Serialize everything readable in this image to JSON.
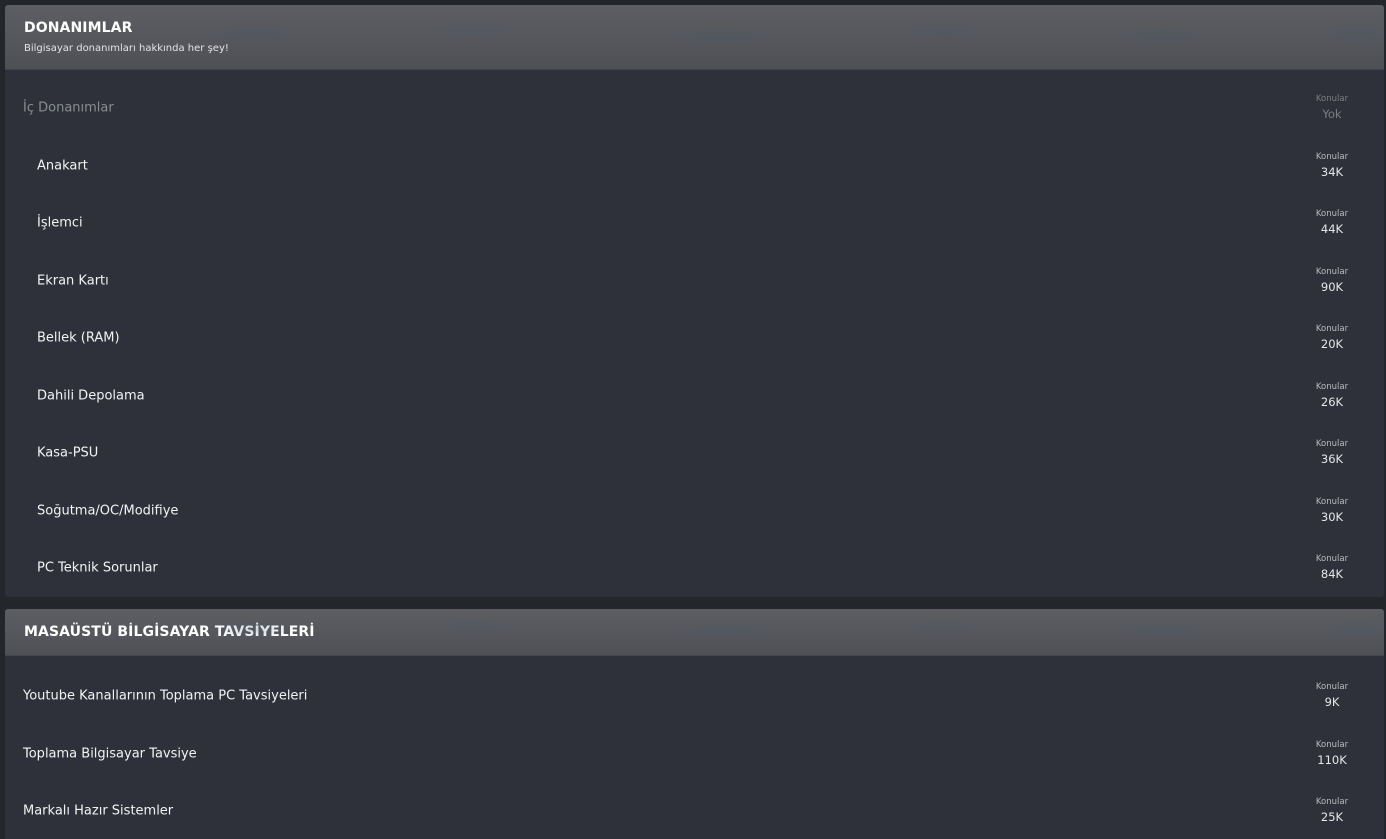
{
  "blocks": [
    {
      "title": "DONANIMLAR",
      "description": "Bilgisayar donanımları hakkında her şey!",
      "category": {
        "title": "İç Donanımlar",
        "stat_label": "Konular",
        "stat_value": "Yok"
      },
      "forums": [
        {
          "title": "Anakart",
          "stat_label": "Konular",
          "stat_value": "34K"
        },
        {
          "title": "İşlemci",
          "stat_label": "Konular",
          "stat_value": "44K"
        },
        {
          "title": "Ekran Kartı",
          "stat_label": "Konular",
          "stat_value": "90K"
        },
        {
          "title": "Bellek (RAM)",
          "stat_label": "Konular",
          "stat_value": "20K"
        },
        {
          "title": "Dahili Depolama",
          "stat_label": "Konular",
          "stat_value": "26K"
        },
        {
          "title": "Kasa-PSU",
          "stat_label": "Konular",
          "stat_value": "36K"
        },
        {
          "title": "Soğutma/OC/Modifiye",
          "stat_label": "Konular",
          "stat_value": "30K"
        },
        {
          "title": "PC Teknik Sorunlar",
          "stat_label": "Konular",
          "stat_value": "84K"
        }
      ]
    },
    {
      "title": "MASAÜSTÜ BİLGİSAYAR TAVSİYELERİ",
      "forums": [
        {
          "title": "Youtube Kanallarının Toplama PC Tavsiyeleri",
          "stat_label": "Konular",
          "stat_value": "9K"
        },
        {
          "title": "Toplama Bilgisayar Tavsiye",
          "stat_label": "Konular",
          "stat_value": "110K"
        },
        {
          "title": "Markalı Hazır Sistemler",
          "stat_label": "Konular",
          "stat_value": "25K"
        }
      ]
    }
  ]
}
